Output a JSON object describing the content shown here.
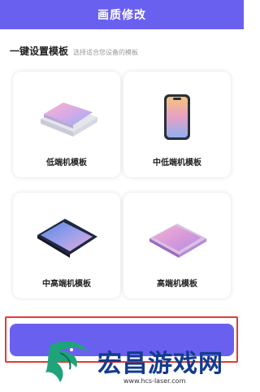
{
  "header": {
    "title": "画质修改"
  },
  "section": {
    "title": "一键设置模板",
    "subtitle": "选择适合您设备的模板"
  },
  "templates": [
    {
      "label": "低端机模板",
      "icon": "tablet-flat-icon"
    },
    {
      "label": "中低端机模板",
      "icon": "phone-upright-icon"
    },
    {
      "label": "中高端机模板",
      "icon": "phone-flat-blue-icon"
    },
    {
      "label": "高端机模板",
      "icon": "phone-flat-pink-icon"
    }
  ],
  "confirm_button": {
    "label": ""
  },
  "watermark": {
    "title": "宏昌游戏网",
    "url": "www.hcs-laser.com"
  },
  "colors": {
    "accent": "#6a60ef",
    "highlight_border": "#e53a31",
    "watermark_text": "#123b8f"
  }
}
